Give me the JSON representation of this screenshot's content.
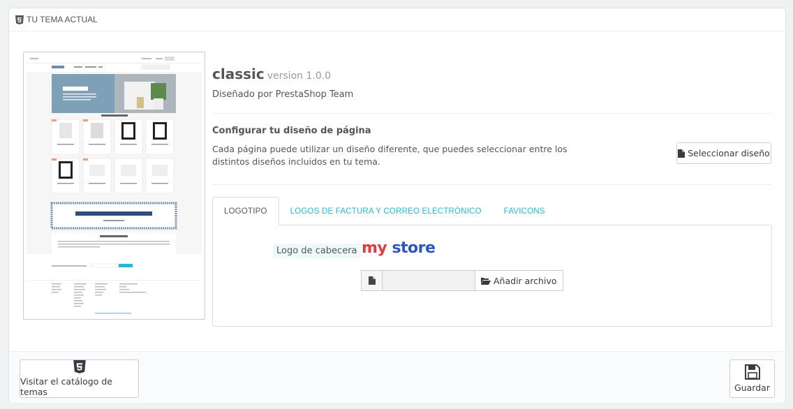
{
  "panel": {
    "heading": "TU TEMA ACTUAL"
  },
  "theme": {
    "name": "classic",
    "version": "version 1.0.0",
    "designer": "Diseñado por PrestaShop Team"
  },
  "layout_section": {
    "title": "Configurar tu diseño de página",
    "description": "Cada página puede utilizar un diseño diferente, que puedes seleccionar entre los distintos diseños incluidos en tu tema.",
    "select_button": "Seleccionar diseño"
  },
  "tabs": [
    {
      "label": "LOGOTIPO",
      "active": true
    },
    {
      "label": "LOGOS DE FACTURA Y CORREO ELECTRÓNICO",
      "active": false
    },
    {
      "label": "FAVICONS",
      "active": false
    }
  ],
  "logo_tab": {
    "label": "Logo de cabecera",
    "logo_word1": "my",
    "logo_word2": "store",
    "add_file_button": "Añadir archivo"
  },
  "preview": {
    "banner_title": "SAMPLE 1",
    "popular_label": "POPULAR PRODUCTS",
    "promo_text": "20% OFF ON CLOTHES",
    "promo_sub": "SEE MORE",
    "custom_block": "CUSTOM TEXT BLOCK",
    "subscribe": "Subscribe"
  },
  "footer": {
    "visit_catalog": "Visitar el catálogo de temas",
    "save": "Guardar"
  },
  "colors": {
    "accent": "#25b9d7",
    "logo_red": "#e33a3a",
    "logo_blue": "#2b56c6"
  }
}
